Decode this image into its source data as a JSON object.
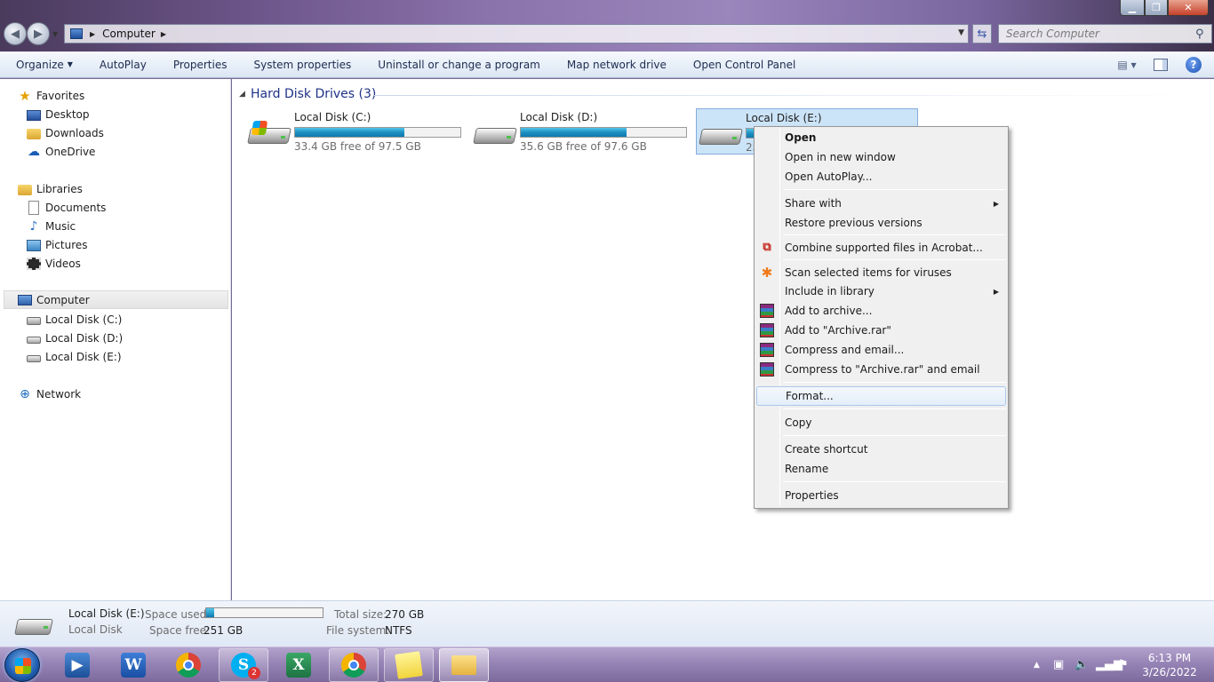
{
  "window": {
    "address": "Computer",
    "search_placeholder": "Search Computer",
    "controls": [
      "minimize",
      "maximize",
      "close"
    ]
  },
  "toolbar": {
    "items": [
      "Organize",
      "AutoPlay",
      "Properties",
      "System properties",
      "Uninstall or change a program",
      "Map network drive",
      "Open Control Panel"
    ]
  },
  "nav": {
    "favorites": "Favorites",
    "desktop": "Desktop",
    "downloads": "Downloads",
    "onedrive": "OneDrive",
    "libraries": "Libraries",
    "documents": "Documents",
    "music": "Music",
    "pictures": "Pictures",
    "videos": "Videos",
    "computer": "Computer",
    "disk_c": "Local Disk (C:)",
    "disk_d": "Local Disk (D:)",
    "disk_e": "Local Disk (E:)",
    "network": "Network"
  },
  "content": {
    "group_title": "Hard Disk Drives (3)",
    "drives": [
      {
        "name": "Local Disk (C:)",
        "free": "33.4 GB free of 97.5 GB",
        "used_fraction": 0.66
      },
      {
        "name": "Local Disk (D:)",
        "free": "35.6 GB free of 97.6 GB",
        "used_fraction": 0.64
      },
      {
        "name": "Local Disk (E:)",
        "free": "25",
        "used_fraction": 0.07
      }
    ]
  },
  "context_menu": {
    "open": "Open",
    "open_new_window": "Open in new window",
    "open_autoplay": "Open AutoPlay...",
    "share_with": "Share with",
    "restore_versions": "Restore previous versions",
    "combine_acrobat": "Combine supported files in Acrobat...",
    "scan_viruses": "Scan selected items for viruses",
    "include_library": "Include in library",
    "add_archive": "Add to archive...",
    "add_archive_rar": "Add to \"Archive.rar\"",
    "compress_email": "Compress and email...",
    "compress_rar_email": "Compress to \"Archive.rar\" and email",
    "format": "Format...",
    "copy": "Copy",
    "create_shortcut": "Create shortcut",
    "rename": "Rename",
    "properties": "Properties"
  },
  "details": {
    "name": "Local Disk (E:)",
    "type": "Local Disk",
    "space_used_label": "Space used:",
    "space_used_fraction": 0.07,
    "space_free_label": "Space free:",
    "space_free_value": "251 GB",
    "total_size_label": "Total size:",
    "total_size_value": "270 GB",
    "file_system_label": "File system:",
    "file_system_value": "NTFS"
  },
  "taskbar": {
    "apps": [
      "media-player",
      "word",
      "chrome",
      "skype",
      "excel",
      "chrome",
      "sticky-notes",
      "explorer"
    ],
    "skype_badge": "2",
    "time": "6:13 PM",
    "date": "3/26/2022"
  }
}
